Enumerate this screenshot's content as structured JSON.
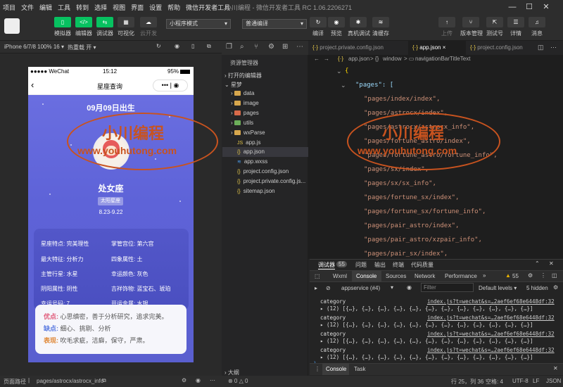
{
  "menu": [
    "项目",
    "文件",
    "编辑",
    "工具",
    "转到",
    "选择",
    "视图",
    "界面",
    "设置",
    "帮助",
    "微信开发者工具"
  ],
  "window_title": "小川编程 - 微信开发者工具 RC 1.06.2206271",
  "toolbar": {
    "simulator": "模拟器",
    "editor": "编辑器",
    "debugger": "调试器",
    "visual": "可视化",
    "cloud": "云开发",
    "mode_select": "小程序模式",
    "compile_select": "普通编译",
    "compile": "编译",
    "preview": "预览",
    "real_debug": "真机调试",
    "clear_cache": "清缓存",
    "upload": "上传",
    "version": "版本管理",
    "test": "测试号",
    "details": "详情",
    "messages": "消息"
  },
  "simbar": {
    "device": "iPhone 6/7/8 100% 16 ▾",
    "hot_reload": "热重载 开 ▾"
  },
  "phone": {
    "carrier": "●●●●● WeChat",
    "time": "15:12",
    "battery": "95%",
    "nav_title": "星座查询",
    "birthday": "09月09日出生",
    "sign": "处女座",
    "sign_tag": "太阳星座",
    "date_range": "8.23-9.22",
    "info": [
      {
        "k": "星座特点:",
        "v": "完美理性"
      },
      {
        "k": "掌管宫位:",
        "v": "第六宫"
      },
      {
        "k": "最大特征:",
        "v": "分析力"
      },
      {
        "k": "四象属性:",
        "v": "土"
      },
      {
        "k": "主管行星:",
        "v": "水星"
      },
      {
        "k": "幸运颜色:",
        "v": "灰色"
      },
      {
        "k": "阴阳属性:",
        "v": "阴性"
      },
      {
        "k": "吉祥饰物:",
        "v": "蓝宝石、琥珀"
      },
      {
        "k": "幸运号码:",
        "v": "7"
      },
      {
        "k": "开运金属:",
        "v": "水银"
      }
    ],
    "traits": [
      {
        "k": "优点:",
        "v": "心思缜密，善于分析研究，追求完美。"
      },
      {
        "k": "缺点:",
        "v": "细心、挑剔、分析"
      },
      {
        "k": "表现:",
        "v": "吹毛求疵，洁癖，保守，严肃。"
      }
    ]
  },
  "explorer": {
    "title": "资源管理器",
    "open_editors": "打开的编辑器",
    "project": "星梦",
    "items": [
      {
        "name": "data",
        "type": "folder"
      },
      {
        "name": "image",
        "type": "folder"
      },
      {
        "name": "pages",
        "type": "folder"
      },
      {
        "name": "utils",
        "type": "folder"
      },
      {
        "name": "wxParse",
        "type": "folder"
      },
      {
        "name": "app.js",
        "type": "js"
      },
      {
        "name": "app.json",
        "type": "json"
      },
      {
        "name": "app.wxss",
        "type": "wxss"
      },
      {
        "name": "project.config.json",
        "type": "json"
      },
      {
        "name": "project.private.config.js...",
        "type": "json"
      },
      {
        "name": "sitemap.json",
        "type": "json"
      }
    ],
    "outline": "大纲"
  },
  "tabs": [
    "project.private.config.json",
    "app.json",
    "project.config.json"
  ],
  "breadcrumb": {
    "file": "app.json",
    "window": "window",
    "key": "navigationBarTitleText"
  },
  "code_lines": [
    "{",
    "\"pages\": [",
    "\"pages/index/index\",",
    "\"pages/astrocx/index\",",
    "\"pages/astrocx/astrocx_info\",",
    "\"pages/fortune_astro/index\",",
    "\"pages/fortune_astro/fortune_info\",",
    "\"pages/sx/index\",",
    "\"pages/sx/sx_info\",",
    "\"pages/fortune_sx/index\",",
    "\"pages/fortune_sx/fortune_info\",",
    "\"pages/pair_astro/index\",",
    "\"pages/pair_astro/xzpair_info\",",
    "\"pages/pair_sx/index\","
  ],
  "devtools": {
    "tabs": [
      "调试器",
      "55",
      "问题",
      "输出",
      "终端",
      "代码质量"
    ],
    "subtabs": [
      "Wxml",
      "Console",
      "Sources",
      "Network",
      "Performance"
    ],
    "warnings": "55",
    "context": "appservice (#4)",
    "filter": "Filter",
    "levels": "Default levels ▾",
    "hidden": "5 hidden",
    "logs": [
      {
        "title": "category",
        "detail": "▸ (12) [{…}, {…}, {…}, {…}, {…}, {…}, {…}, {…}, {…}, {…}, {…}, {…}]",
        "link": "index.js?t=wechat&s=…2aef6ef68e6448df:32"
      },
      {
        "title": "category",
        "detail": "▸ (12) [{…}, {…}, {…}, {…}, {…}, {…}, {…}, {…}, {…}, {…}, {…}, {…}]",
        "link": "index.js?t=wechat&s=…2aef6ef68e6448df:32"
      },
      {
        "title": "category",
        "detail": "▸ (12) [{…}, {…}, {…}, {…}, {…}, {…}, {…}, {…}, {…}, {…}, {…}, {…}]",
        "link": "index.js?t=wechat&s=…2aef6ef68e6448df:32"
      },
      {
        "title": "category",
        "detail": "▸ (12) [{…}, {…}, {…}, {…}, {…}, {…}, {…}, {…}, {…}, {…}, {…}, {…}]",
        "link": "index.js?t=wechat&s=…2aef6ef68e6448df:32"
      }
    ],
    "bottom_tabs": [
      "Console",
      "Task"
    ]
  },
  "statusbar": {
    "path_label": "页面路径",
    "path": "pages/astrocx/astrocx_info",
    "errors": "⊗ 0 △ 0",
    "cursor": "行 25，列 36",
    "spaces": "空格: 4",
    "encoding": "UTF-8",
    "eol": "LF",
    "lang": "JSON"
  },
  "watermark": {
    "name": "小川编程",
    "url": "www.youhutong.com"
  }
}
